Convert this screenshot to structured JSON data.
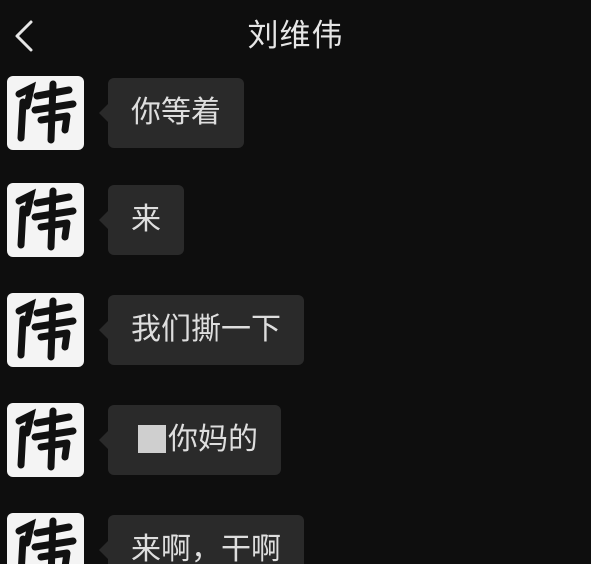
{
  "header": {
    "title": "刘维伟",
    "back_icon": "chevron-left-icon"
  },
  "avatar": {
    "glyph": "伟",
    "background": "#f4f4f4",
    "ink": "#111111"
  },
  "messages": [
    {
      "text": "你等着",
      "redacted_prefix": false
    },
    {
      "text": "来",
      "redacted_prefix": false
    },
    {
      "text": "我们撕一下",
      "redacted_prefix": false
    },
    {
      "text": "你妈的",
      "redacted_prefix": true
    },
    {
      "text": "来啊，干啊",
      "redacted_prefix": false
    }
  ],
  "colors": {
    "background": "#0e0e0e",
    "bubble": "#2a2a2a",
    "text": "#dedede"
  }
}
